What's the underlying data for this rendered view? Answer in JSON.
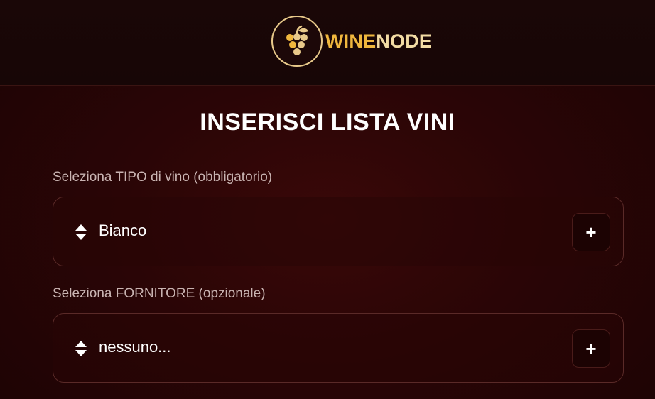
{
  "brand": {
    "name_part1": "WINE",
    "name_part2": "NODE",
    "logo_icon": "grapes-icon",
    "colors": {
      "gold": "#f0b73e",
      "cream": "#f3dca4"
    }
  },
  "page": {
    "title": "INSERISCI LISTA VINI"
  },
  "form": {
    "wine_type": {
      "label": "Seleziona TIPO di vino (obbligatorio)",
      "value": "Bianco",
      "add_button": "+"
    },
    "supplier": {
      "label": "Seleziona FORNITORE (opzionale)",
      "value": "nessuno...",
      "add_button": "+"
    }
  }
}
